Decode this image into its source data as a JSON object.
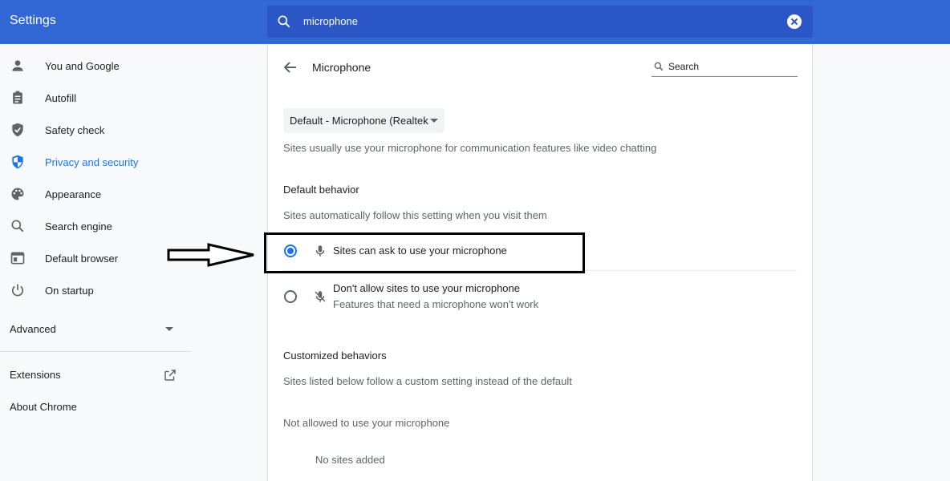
{
  "header": {
    "app_title": "Settings",
    "search_value": "microphone",
    "search_icon": "search-icon",
    "clear_icon": "clear-search-icon"
  },
  "sidebar": {
    "items": [
      {
        "label": "You and Google",
        "icon": "person-icon"
      },
      {
        "label": "Autofill",
        "icon": "clipboard-icon"
      },
      {
        "label": "Safety check",
        "icon": "shield-check-icon"
      },
      {
        "label": "Privacy and security",
        "icon": "shield-icon",
        "active": true
      },
      {
        "label": "Appearance",
        "icon": "palette-icon"
      },
      {
        "label": "Search engine",
        "icon": "search-icon"
      },
      {
        "label": "Default browser",
        "icon": "browser-icon"
      },
      {
        "label": "On startup",
        "icon": "power-icon"
      }
    ],
    "advanced_label": "Advanced",
    "extensions_label": "Extensions",
    "about_label": "About Chrome"
  },
  "page": {
    "title": "Microphone",
    "search_placeholder": "Search",
    "device_select_value": "Default - Microphone (Realtek",
    "description": "Sites usually use your microphone for communication features like video chatting",
    "default_behavior_heading": "Default behavior",
    "default_behavior_sub": "Sites automatically follow this setting when you visit them",
    "option_allow": "Sites can ask to use your microphone",
    "option_block": "Don't allow sites to use your microphone",
    "option_block_sub": "Features that need a microphone won't work",
    "selected_option": "allow",
    "customized_heading": "Customized behaviors",
    "customized_sub": "Sites listed below follow a custom setting instead of the default",
    "not_allowed_heading": "Not allowed to use your microphone",
    "no_sites": "No sites added"
  },
  "colors": {
    "header_bg": "#3367d6",
    "search_bg": "#2a56c6",
    "accent": "#1a73e8",
    "annotation": "#000000"
  }
}
